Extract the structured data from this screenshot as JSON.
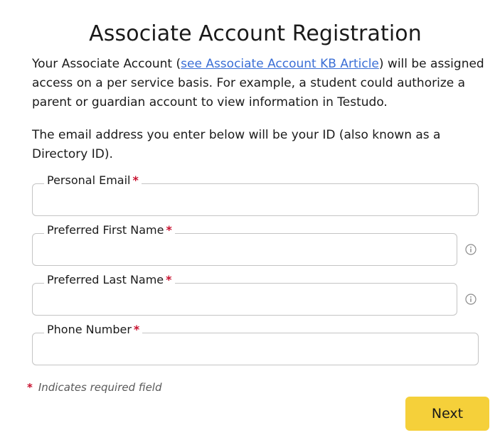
{
  "page": {
    "title": "Associate Account Registration"
  },
  "intro": {
    "text_before_link": "Your Associate Account (",
    "link_text": "see Associate Account KB Article",
    "text_after_link": ") will be assigned access on a per service basis. For example, a student could authorize a parent or guardian account to view information in Testudo."
  },
  "id_note": "The email address you enter below will be your ID (also known as a Directory ID).",
  "fields": {
    "personal_email": {
      "label": "Personal Email",
      "required_mark": "*",
      "value": ""
    },
    "first_name": {
      "label": "Preferred First Name",
      "required_mark": "*",
      "value": "",
      "info_icon": "info-circle-icon"
    },
    "last_name": {
      "label": "Preferred Last Name",
      "required_mark": "*",
      "value": "",
      "info_icon": "info-circle-icon"
    },
    "phone": {
      "label": "Phone Number",
      "required_mark": "*",
      "value": ""
    }
  },
  "required_note": {
    "mark": "*",
    "text": "Indicates required field"
  },
  "actions": {
    "next_label": "Next"
  },
  "colors": {
    "link": "#3b6fd6",
    "required": "#c8102e",
    "button_bg": "#f5d03a",
    "field_border": "#c4c4c4"
  }
}
